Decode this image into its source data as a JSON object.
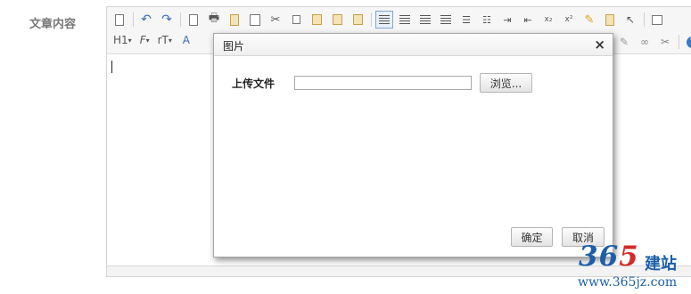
{
  "form": {
    "label": "文章内容"
  },
  "toolbar": {
    "heading_label": "H1",
    "font_family_label": "F",
    "font_size_label": "rT",
    "extra_label": "A",
    "help_label": "?",
    "superscript_label": "x²",
    "subscript_label": "x₂"
  },
  "dialog": {
    "title": "图片",
    "close_glyph": "×",
    "upload_label": "上传文件",
    "file_value": "",
    "browse_label": "浏览...",
    "ok_label": "确定",
    "cancel_label": "取消"
  },
  "watermark": {
    "numbers_a": "36",
    "numbers_b": "5",
    "brand_cn": "建站",
    "url": "www.365jz.com"
  }
}
